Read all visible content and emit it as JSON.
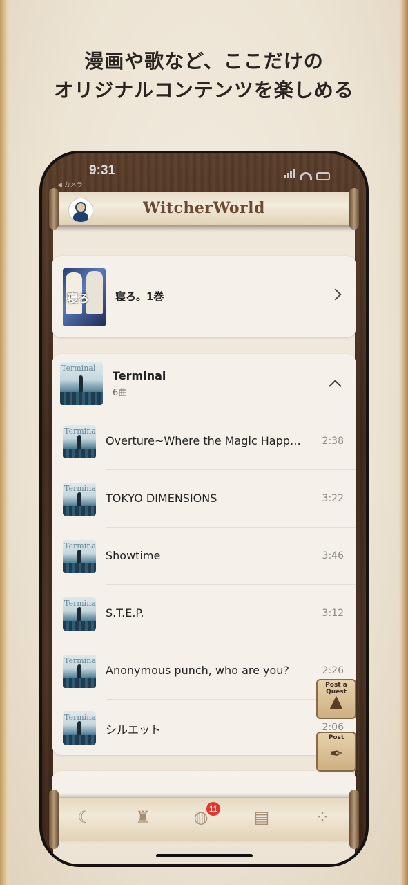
{
  "promo": {
    "line1": "漫画や歌など、ここだけの",
    "line2": "オリジナルコンテンツを楽しめる"
  },
  "status_bar": {
    "time": "9:31",
    "back_label": "◀ カメラ"
  },
  "header": {
    "app_name": "WitcherWorld"
  },
  "manga": {
    "cover_text": "寝ろ",
    "title": "寝ろ。1巻"
  },
  "album": {
    "cover_text": "Terminal",
    "title": "Terminal",
    "track_count": "6曲",
    "tracks": [
      {
        "title": "Overture~Where the Magic Happe...",
        "duration": "2:38"
      },
      {
        "title": "TOKYO DIMENSIONS",
        "duration": "3:22"
      },
      {
        "title": "Showtime",
        "duration": "3:46"
      },
      {
        "title": "S.T.E.P.",
        "duration": "3:12"
      },
      {
        "title": "Anonymous punch, who are you?",
        "duration": "2:26"
      },
      {
        "title": "シルエット",
        "duration": "2:06"
      }
    ]
  },
  "floating": {
    "quest_label": "Post a Quest",
    "post_label": "Post"
  },
  "nav": {
    "badge_count": "11",
    "icons": [
      "witch-icon",
      "castle-icon",
      "globe-icon",
      "map-icon",
      "footprints-icon"
    ]
  },
  "colors": {
    "badge": "#e0382e",
    "wood": "#4a3222",
    "parchment": "#f5f1ea"
  }
}
